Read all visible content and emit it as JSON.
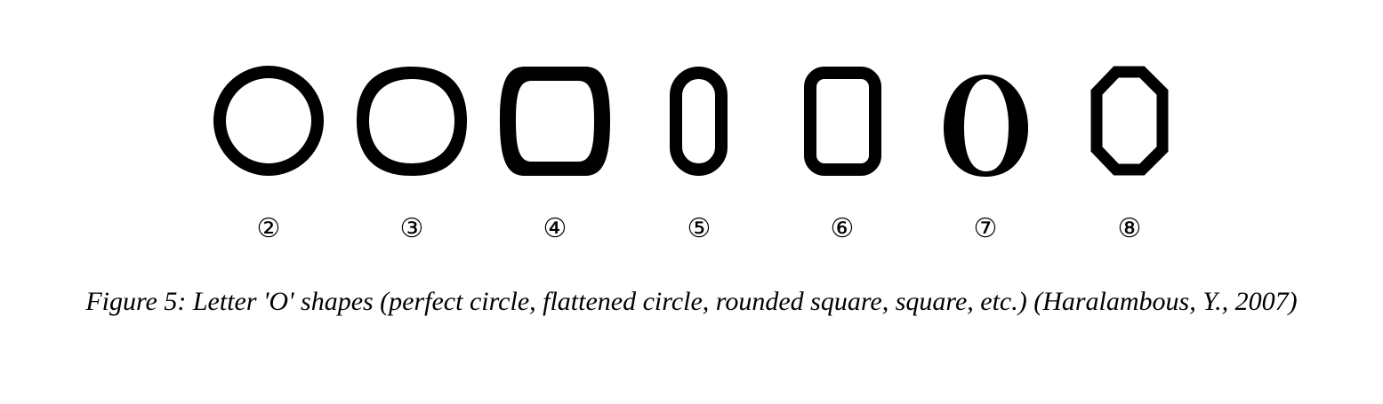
{
  "figure": {
    "shapes": [
      {
        "name": "perfect-circle",
        "label": "②"
      },
      {
        "name": "flattened-circle",
        "label": "③"
      },
      {
        "name": "rounded-square",
        "label": "④"
      },
      {
        "name": "narrow-stadium",
        "label": "⑤"
      },
      {
        "name": "rounded-rectangle",
        "label": "⑥"
      },
      {
        "name": "serif-oval",
        "label": "⑦"
      },
      {
        "name": "octagon",
        "label": "⑧"
      }
    ],
    "caption": "Figure 5: Letter 'O' shapes (perfect circle, flattened circle, rounded square, square, etc.) (Haralambous, Y., 2007)",
    "colors": {
      "ink": "#000000",
      "background": "#ffffff"
    }
  }
}
